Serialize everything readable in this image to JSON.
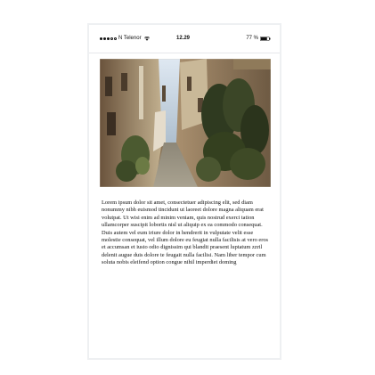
{
  "status_bar": {
    "carrier": "N Telenor",
    "time": "12.29",
    "battery": "77 %",
    "signal_icon": "signal-dots-icon",
    "wifi_icon": "wifi-icon",
    "battery_icon": "battery-icon"
  },
  "photo": {
    "subject": "narrow alley between old buildings"
  },
  "article": {
    "body": "Lorem ipsum dolor sit amet, consectetuer adipiscing elit, sed diam nonummy nibh euismod tincidunt ut laoreet dolore magna aliquam erat volutpat. Ut wisi enim ad minim veniam, quis nostrud exerci tation ullamcorper suscipit lobortis nisl ut aliquip ex ea commodo consequat. Duis autem vel eum iriure dolor in hendrerit in vulputate velit esse molestie consequat, vel illum dolore eu feugiat nulla facilisis at vero eros et accumsan et iusto odio dignissim qui blandit praesent luptatum zzril delenit augue duis dolore te feugait nulla facilisi. Nam liber tempor cum soluta nobis eleifend option congue nihil imperdiet doming"
  }
}
